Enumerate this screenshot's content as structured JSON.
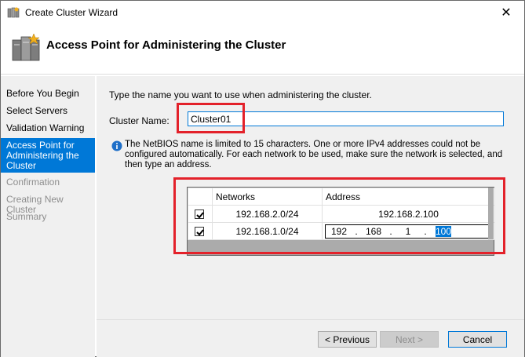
{
  "window": {
    "title": "Create Cluster Wizard"
  },
  "header": {
    "page_title": "Access Point for Administering the Cluster",
    "icon": "cluster-servers-icon"
  },
  "nav": {
    "items": [
      {
        "label": "Before You Begin",
        "state": "normal"
      },
      {
        "label": "Select Servers",
        "state": "normal"
      },
      {
        "label": "Validation Warning",
        "state": "normal"
      },
      {
        "label": "Access Point for Administering the Cluster",
        "state": "active"
      },
      {
        "label": "Confirmation",
        "state": "disabled"
      },
      {
        "label": "Creating New Cluster",
        "state": "disabled"
      },
      {
        "label": "Summary",
        "state": "disabled"
      }
    ]
  },
  "main": {
    "instruction": "Type the name you want to use when administering the cluster.",
    "cluster_name_label": "Cluster Name:",
    "cluster_name_value": "Cluster01",
    "info_text": "The NetBIOS name is limited to 15 characters.  One or more IPv4 addresses could not be configured automatically.  For each network to be used, make sure the network is selected, and then type an address.",
    "grid": {
      "headers": [
        "Networks",
        "Address"
      ],
      "rows": [
        {
          "checked": true,
          "network": "192.168.2.0/24",
          "address": "192.168.2.100"
        },
        {
          "checked": true,
          "network": "192.168.1.0/24",
          "octets": [
            "192",
            "168",
            "1",
            "100"
          ]
        }
      ]
    }
  },
  "footer": {
    "previous_label": "< Previous",
    "next_label": "Next >",
    "cancel_label": "Cancel"
  },
  "colors": {
    "accent": "#0078d7",
    "highlight": "#e3212a",
    "panel": "#f0f0f0"
  }
}
